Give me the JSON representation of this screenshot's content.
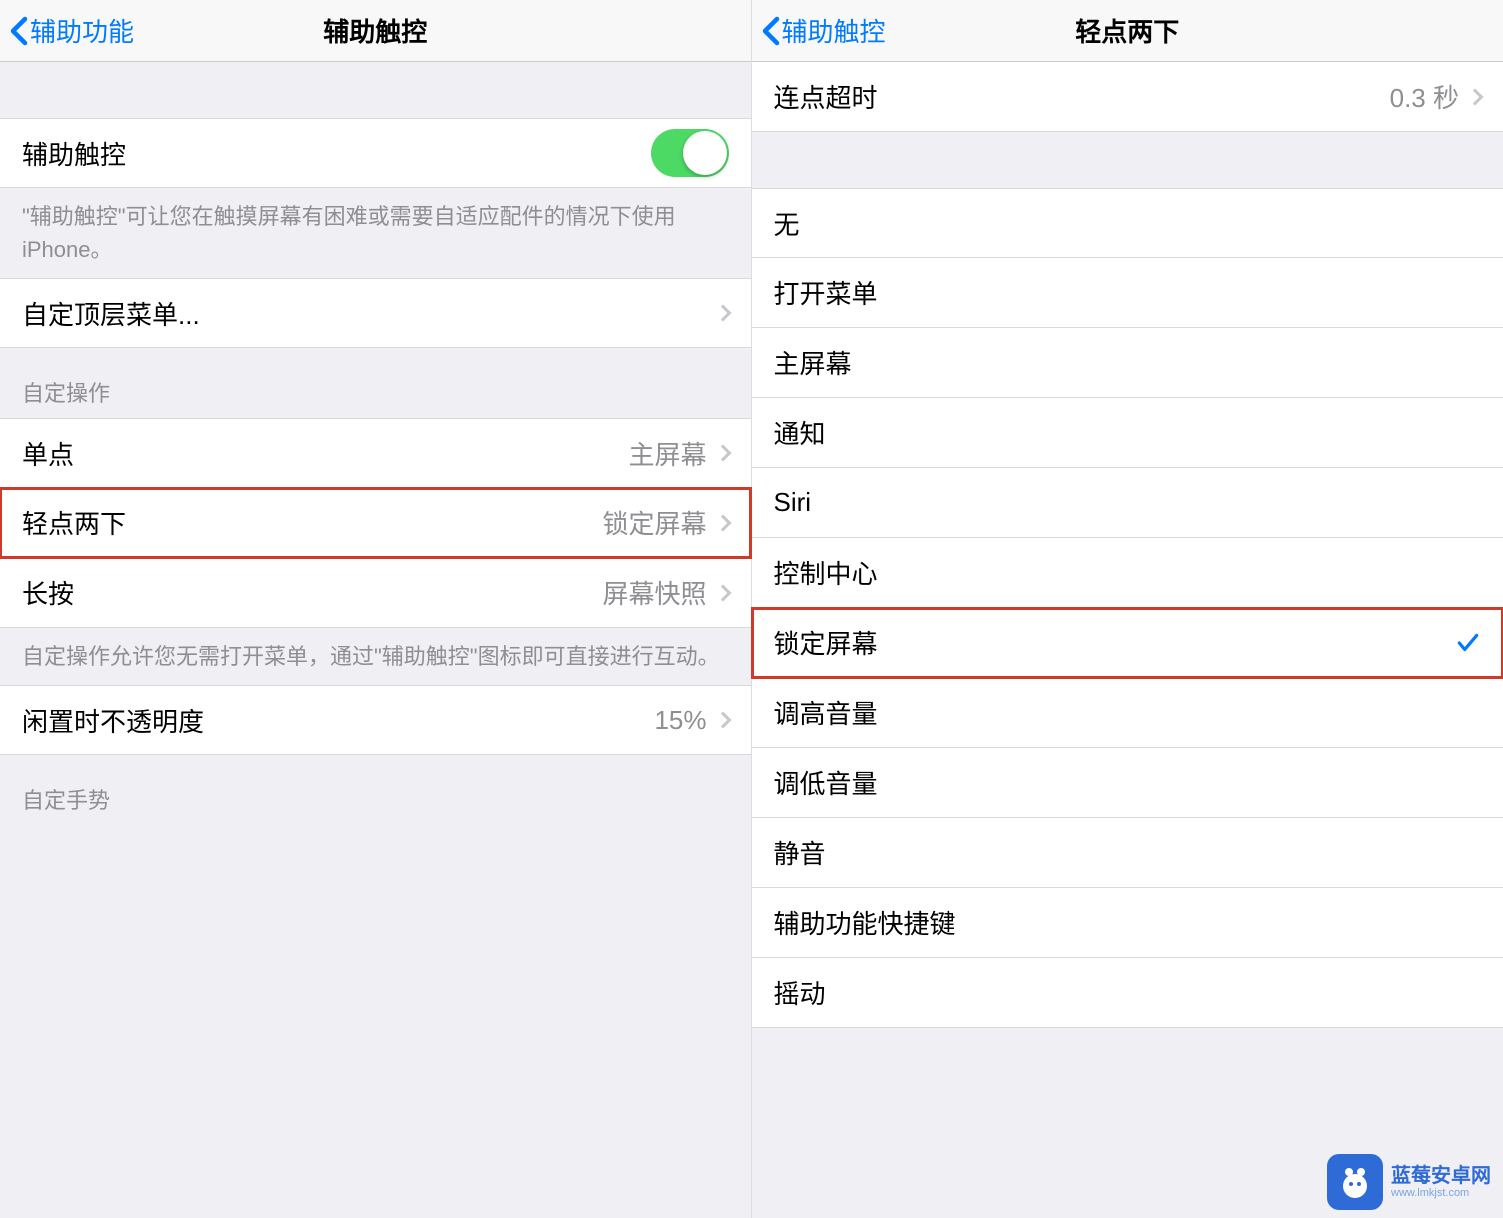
{
  "left": {
    "back": "辅助功能",
    "title": "辅助触控",
    "toggle_label": "辅助触控",
    "toggle_desc": "\"辅助触控\"可让您在触摸屏幕有困难或需要自适应配件的情况下使用 iPhone。",
    "custom_top_menu": "自定顶层菜单...",
    "custom_actions_header": "自定操作",
    "actions": {
      "single_tap_label": "单点",
      "single_tap_value": "主屏幕",
      "double_tap_label": "轻点两下",
      "double_tap_value": "锁定屏幕",
      "long_press_label": "长按",
      "long_press_value": "屏幕快照"
    },
    "custom_actions_desc": "自定操作允许您无需打开菜单，通过\"辅助触控\"图标即可直接进行互动。",
    "idle_opacity_label": "闲置时不透明度",
    "idle_opacity_value": "15%",
    "custom_gestures_header": "自定手势"
  },
  "right": {
    "back": "辅助触控",
    "title": "轻点两下",
    "timeout_label": "连点超时",
    "timeout_value": "0.3 秒",
    "options": [
      "无",
      "打开菜单",
      "主屏幕",
      "通知",
      "Siri",
      "控制中心",
      "锁定屏幕",
      "调高音量",
      "调低音量",
      "静音",
      "辅助功能快捷键",
      "摇动"
    ],
    "selected_index": 6
  },
  "watermark": {
    "title": "蓝莓安卓网",
    "url": "www.lmkjst.com"
  }
}
